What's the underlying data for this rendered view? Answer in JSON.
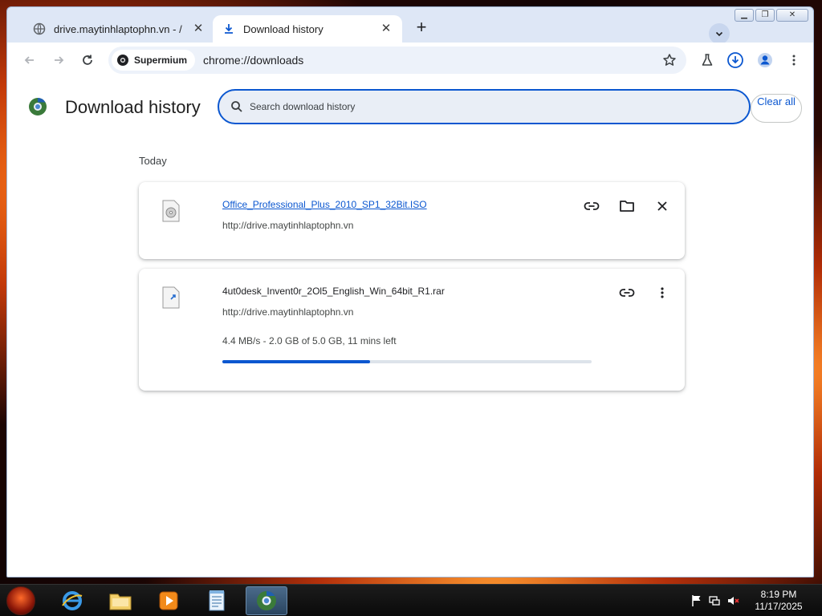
{
  "tabs": [
    {
      "title": "drive.maytinhlaptophn.vn - /",
      "active": false,
      "icon": "globe-icon"
    },
    {
      "title": "Download history",
      "active": true,
      "icon": "download-icon"
    }
  ],
  "toolbar": {
    "site_label": "Supermium",
    "url": "chrome://downloads"
  },
  "page": {
    "title": "Download history",
    "search_placeholder": "Search download history",
    "clear_all": "Clear all"
  },
  "downloads": {
    "section": "Today",
    "items": [
      {
        "name": "Office_Professional_Plus_2010_SP1_32Bit.ISO",
        "url": "http://drive.maytinhlaptophn.vn",
        "completed": true
      },
      {
        "name": "4ut0desk_Invent0r_2Ol5_English_Win_64bit_R1.rar",
        "url": "http://drive.maytinhlaptophn.vn",
        "status": "4.4 MB/s - 2.0 GB of 5.0 GB, 11 mins left",
        "progress": 0.4,
        "completed": false
      }
    ]
  },
  "taskbar": {
    "time": "8:19 PM",
    "date": "11/17/2025"
  },
  "colors": {
    "accent": "#0b57d0",
    "tab_strip": "#dee7f6"
  }
}
